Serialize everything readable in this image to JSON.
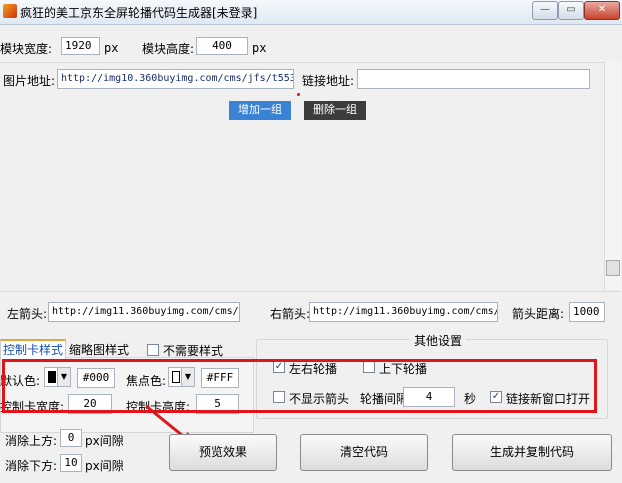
{
  "window": {
    "title": "疯狂的美工京东全屏轮播代码生成器[未登录]",
    "min_glyph": "—",
    "max_glyph": "▭",
    "close_glyph": "✕"
  },
  "size": {
    "width_label": "模块宽度:",
    "width_value": "1920",
    "unit": "px",
    "height_label": "模块高度:",
    "height_value": "400",
    "unit2": "px"
  },
  "image": {
    "label": "图片地址:",
    "value": "http://img10.360buyimg.com/cms/jfs/t553/1",
    "link_label": "链接地址:",
    "link_value": ""
  },
  "group_buttons": {
    "add": "增加一组",
    "delete": "删除一组"
  },
  "arrows": {
    "left_label": "左箭头:",
    "left_value": "http://img11.360buyimg.com/cms/jf",
    "right_label": "右箭头:",
    "right_value": "http://img11.360buyimg.com/cms/j",
    "distance_label": "箭头距离:",
    "distance_value": "1000"
  },
  "tabs": {
    "control": "控制卡样式",
    "thumb": "缩略图样式",
    "no_style_label": "不需要样式"
  },
  "control_style": {
    "default_color_label": "默认色:",
    "default_color_value": "#000",
    "default_swatch": "#000000",
    "focus_color_label": "焦点色:",
    "focus_color_value": "#FFF",
    "focus_swatch": "#ffffff",
    "width_label": "控制卡宽度:",
    "width_value": "20",
    "height_label": "控制卡高度:",
    "height_value": "5"
  },
  "other": {
    "title": "其他设置",
    "lr_label": "左右轮播",
    "lr_checked": true,
    "ud_label": "上下轮播",
    "ud_checked": false,
    "hide_arrow_label": "不显示箭头",
    "hide_arrow_checked": false,
    "interval_label": "轮播间隔:",
    "interval_value": "4",
    "interval_unit": "秒",
    "new_window_label": "链接新窗口打开",
    "new_window_checked": true
  },
  "gaps": {
    "top_label": "消除上方:",
    "top_value": "0",
    "top_unit": "px间隙",
    "bottom_label": "消除下方:",
    "bottom_value": "10",
    "bottom_unit": "px间隙"
  },
  "actions": {
    "preview": "预览效果",
    "clear": "清空代码",
    "generate": "生成并复制代码"
  },
  "icons": {
    "app": "app-logo-icon",
    "check": "✓",
    "dropdown": "▼"
  },
  "colors": {
    "highlight_box": "#e0141b",
    "blue_button": "#3a82d3",
    "dark_button": "#3c3c3c"
  }
}
